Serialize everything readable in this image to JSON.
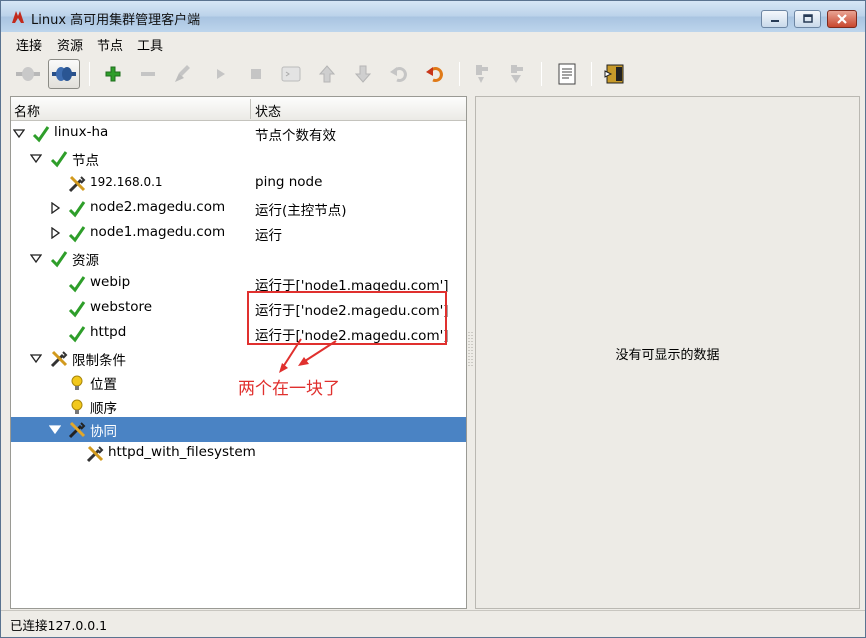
{
  "window": {
    "title": "Linux 高可用集群管理客户端"
  },
  "menubar": {
    "items": [
      "连接",
      "资源",
      "节点",
      "工具"
    ]
  },
  "toolbar": {
    "buttons": [
      "disconnect",
      "connect",
      "add",
      "remove",
      "cleanup",
      "start",
      "stop",
      "default",
      "move-up",
      "move-down",
      "undo",
      "migrate",
      "standby",
      "active",
      "log",
      "exit"
    ]
  },
  "tree": {
    "headers": {
      "name": "名称",
      "status": "状态"
    },
    "rows": [
      {
        "label": "linux-ha",
        "status": "节点个数有效"
      },
      {
        "label": "节点",
        "status": ""
      },
      {
        "label": "192.168.0.1",
        "status": "ping node"
      },
      {
        "label": "node2.magedu.com",
        "status": "运行(主控节点)"
      },
      {
        "label": "node1.magedu.com",
        "status": "运行"
      },
      {
        "label": "资源",
        "status": ""
      },
      {
        "label": "webip",
        "status": "运行于['node1.magedu.com']"
      },
      {
        "label": "webstore",
        "status": "运行于['node2.magedu.com']"
      },
      {
        "label": "httpd",
        "status": "运行于['node2.magedu.com']"
      },
      {
        "label": "限制条件",
        "status": ""
      },
      {
        "label": "位置",
        "status": ""
      },
      {
        "label": "顺序",
        "status": ""
      },
      {
        "label": "协同",
        "status": ""
      },
      {
        "label": "httpd_with_filesystem",
        "status": ""
      }
    ]
  },
  "annotation": {
    "text": "两个在一块了",
    "color": "#e0302e"
  },
  "detail": {
    "empty_message": "没有可显示的数据"
  },
  "statusbar": {
    "text": "已连接127.0.0.1"
  },
  "colors": {
    "selection": "#4a83c4",
    "check": "#2e9e2a",
    "bulb": "#f2c81c"
  }
}
